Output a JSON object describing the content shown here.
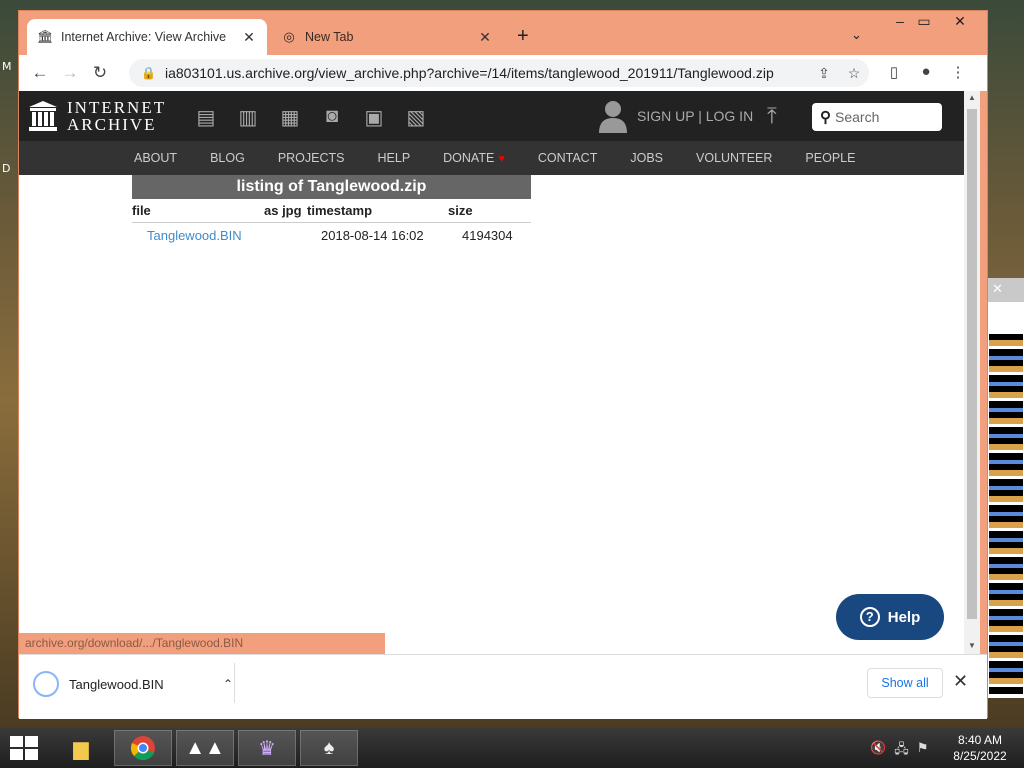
{
  "desktop": {
    "left_glyph_top": "M",
    "left_glyph_mid": "D"
  },
  "browser": {
    "tabs": [
      {
        "label": "Internet Archive: View Archive",
        "active": true
      },
      {
        "label": "New Tab",
        "active": false
      }
    ],
    "new_tab": "+",
    "url": "ia803101.us.archive.org/view_archive.php?archive=/14/items/tanglewood_201911/Tanglewood.zip",
    "status_url": "archive.org/download/.../Tanglewood.BIN"
  },
  "ia": {
    "logo_line1": "INTERNET",
    "logo_line2": "ARCHIVE",
    "signup": "SIGN UP | LOG IN",
    "search_placeholder": "Search",
    "nav": [
      "ABOUT",
      "BLOG",
      "PROJECTS",
      "HELP",
      "DONATE",
      "CONTACT",
      "JOBS",
      "VOLUNTEER",
      "PEOPLE"
    ]
  },
  "listing": {
    "title": "listing of Tanglewood.zip",
    "columns": [
      "file",
      "as jpg",
      "timestamp",
      "size"
    ],
    "rows": [
      {
        "file": "Tanglewood.BIN",
        "as_jpg": "",
        "timestamp": "2018-08-14 16:02",
        "size": "4194304"
      }
    ]
  },
  "help_button": {
    "label": "Help"
  },
  "downloads": {
    "item": "Tanglewood.BIN",
    "show_all": "Show all"
  },
  "taskbar": {
    "time": "8:40 AM",
    "date": "8/25/2022"
  }
}
